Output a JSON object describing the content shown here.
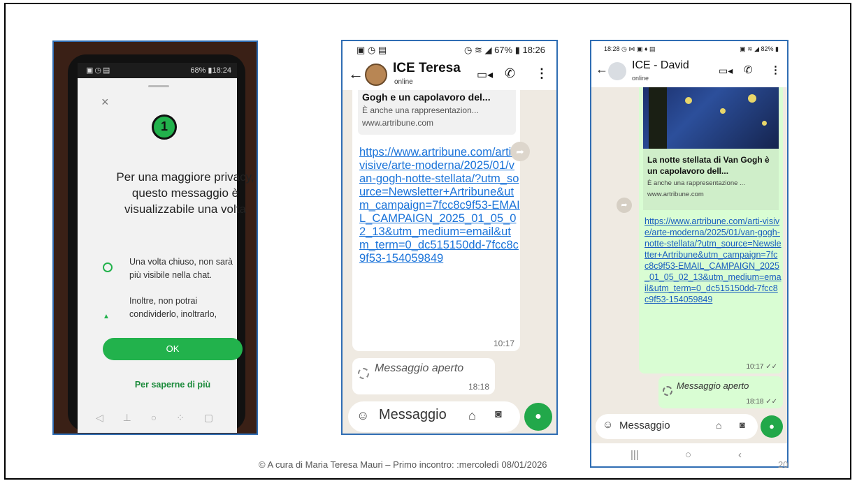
{
  "footer": {
    "text": "© A cura di Maria Teresa Mauri – Primo  incontro: :mercoledì 08/01/2026",
    "page_number": "20"
  },
  "phone1": {
    "status_time": "68% ▮18:24",
    "title": "Per una maggiore privacy, questo messaggio è visualizzabile una volta",
    "once_badge": "1",
    "bullet1": "Una volta chiuso, non sarà più visibile nella chat.",
    "bullet2": "Inoltre, non potrai condividerlo, inoltrarlo,",
    "ok_label": "OK",
    "more_label": "Per saperne di più"
  },
  "phone2": {
    "status_left": "▣ ◷ ▤",
    "status_right": "◷ ≋ ◢ 67% ▮ 18:26",
    "contact_name": "ICE Teresa",
    "contact_status": "online",
    "preview_title": "Gogh e un capolavoro del...",
    "preview_desc": "È anche una rappresentazion...",
    "preview_site": "www.artribune.com",
    "link": "https://www.artribune.com/arti-visive/arte-moderna/2025/01/van-gogh-notte-stellata/?utm_source=Newsletter+Artribune&utm_campaign=7fcc8c9f53-EMAIL_CAMPAIGN_2025_01_05_02_13&utm_medium=email&utm_term=0_dc515150dd-7fcc8c9f53-154059849",
    "link_time": "10:17",
    "opened_text": "Messaggio aperto",
    "opened_time": "18:18",
    "input_placeholder": "Messaggio"
  },
  "phone3": {
    "status_left": "18:28 ◷ ⋈ ▣ ♦ ▤",
    "status_right": "▣ ≋ ◢ 82% ▮",
    "contact_name": "ICE - David",
    "contact_status": "online",
    "preview_title": "La notte stellata di Van Gogh è un capolavoro dell...",
    "preview_desc": "È anche una rappresentazione ...",
    "preview_site": "www.artribune.com",
    "link": "https://www.artribune.com/arti-visive/arte-moderna/2025/01/van-gogh-notte-stellata/?utm_source=Newsletter+Artribune&utm_campaign=7fcc8c9f53-EMAIL_CAMPAIGN_2025_01_05_02_13&utm_medium=email&utm_term=0_dc515150dd-7fcc8c9f53-154059849",
    "link_time": "10:17 ✓✓",
    "opened_text": "Messaggio aperto",
    "opened_time": "18:18 ✓✓",
    "input_placeholder": "Messaggio"
  },
  "colors": {
    "whatsapp_green": "#22a84a",
    "link_blue": "#1a73d9",
    "frame_blue": "#2f6db3"
  }
}
